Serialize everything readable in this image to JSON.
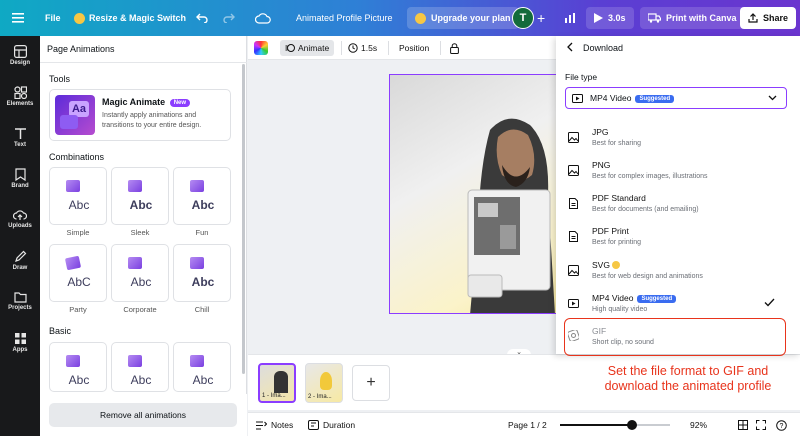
{
  "topbar": {
    "file_label": "File",
    "resize_label": "Resize & Magic Switch",
    "doc_title": "Animated Profile Picture",
    "upgrade_label": "Upgrade your plan",
    "avatar_initial": "T",
    "duration_label": "3.0s",
    "print_label": "Print with Canva",
    "share_label": "Share"
  },
  "rail": {
    "items": [
      {
        "label": "Design",
        "icon": "layout-icon"
      },
      {
        "label": "Elements",
        "icon": "shapes-icon"
      },
      {
        "label": "Text",
        "icon": "text-icon"
      },
      {
        "label": "Brand",
        "icon": "brand-icon"
      },
      {
        "label": "Uploads",
        "icon": "cloud-upload-icon"
      },
      {
        "label": "Draw",
        "icon": "pen-icon"
      },
      {
        "label": "Projects",
        "icon": "folder-icon"
      },
      {
        "label": "Apps",
        "icon": "apps-icon"
      }
    ]
  },
  "panel": {
    "title": "Page Animations",
    "tools_label": "Tools",
    "magic_animate": {
      "title": "Magic Animate",
      "badge": "New",
      "description": "Instantly apply animations and transitions to your entire design."
    },
    "combinations_label": "Combinations",
    "combinations": [
      {
        "label": "Simple",
        "preview": "Abc"
      },
      {
        "label": "Sleek",
        "preview": "Abc"
      },
      {
        "label": "Fun",
        "preview": "Abc"
      },
      {
        "label": "Party",
        "preview": "AbC"
      },
      {
        "label": "Corporate",
        "preview": "Abc"
      },
      {
        "label": "Chill",
        "preview": "Abc"
      }
    ],
    "basic_label": "Basic",
    "basic": [
      {
        "preview": "Abc"
      },
      {
        "preview": "Abc"
      },
      {
        "preview": "Abc"
      }
    ],
    "remove_all_label": "Remove all animations"
  },
  "canvas_toolbar": {
    "animate_label": "Animate",
    "time_label": "1.5s",
    "position_label": "Position"
  },
  "pages": [
    {
      "label": "1 - Ima..."
    },
    {
      "label": "2 - Ima..."
    }
  ],
  "bottombar": {
    "notes_label": "Notes",
    "duration_label": "Duration",
    "page_indicator": "Page 1 / 2",
    "zoom_label": "92%",
    "zoom_value": 0.92
  },
  "download": {
    "title": "Download",
    "file_type_label": "File type",
    "selected_value": "MP4 Video",
    "selected_badge": "Suggested",
    "options": [
      {
        "name": "JPG",
        "desc": "Best for sharing",
        "icon": "image-icon"
      },
      {
        "name": "PNG",
        "desc": "Best for complex images, illustrations",
        "icon": "image-icon"
      },
      {
        "name": "PDF Standard",
        "desc": "Best for documents (and emailing)",
        "icon": "document-icon"
      },
      {
        "name": "PDF Print",
        "desc": "Best for printing",
        "icon": "document-icon"
      },
      {
        "name": "SVG",
        "desc": "Best for web design and animations",
        "icon": "image-icon"
      },
      {
        "name": "MP4 Video",
        "desc": "High quality video",
        "icon": "video-icon",
        "badge": "Suggested"
      },
      {
        "name": "GIF",
        "desc": "Short clip, no sound",
        "icon": "gif-icon"
      }
    ]
  },
  "instruction": "Set the file format to GIF and download the animated profile",
  "colors": {
    "accent": "#8b3dff",
    "highlight": "#e8341c",
    "badge": "#3a6cf0"
  }
}
